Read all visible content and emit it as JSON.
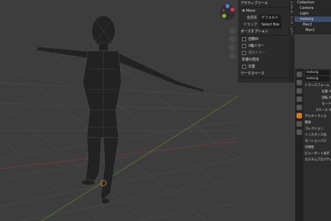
{
  "tool_panel": {
    "active_tool_header": "アクティブツール",
    "move_label": "Move",
    "orientation_label": "座標系",
    "orientation_value": "デフォルト",
    "drag_label": "ドラッグ",
    "drag_value": "Select Box",
    "pose_options_header": "ポーズオプション",
    "auto_ik": "自動IK",
    "x_mirror": "X軸ミラー",
    "relative_mirror": "相対ミラー",
    "affect_only": "影響の限定",
    "location": "位置",
    "workspace_header": "ワークスペース"
  },
  "vertical_tabs": [
    "アイテム",
    "ツール",
    "ビュー"
  ],
  "outliner": {
    "items": [
      "Collection",
      "Camera",
      "Light",
      "metarig",
      "Mac2",
      "Mac2"
    ]
  },
  "properties": {
    "object_name": "metarig",
    "data_name": "metarig",
    "transform_header": "トランスフォーム",
    "location_label": "位置 X",
    "rotation_label": "回転 X",
    "mode_label": "モード",
    "scale_label": "スケール X",
    "delta_header": "デルタトランス",
    "relations": "関係",
    "collections": "コレクション",
    "instancing": "インスタンス化",
    "motion_paths": "モーションパス",
    "visibility": "可視性",
    "viewport_display": "ビューポート表示",
    "custom_props": "カスタムプロパティ"
  },
  "colors": {
    "accent": "#3a4d6e",
    "x_axis": "#b84a4a",
    "y_axis": "#7aa02a"
  },
  "icons": [
    "move-icon",
    "zoom-icon",
    "hand-icon",
    "camera-icon",
    "grid-icon",
    "navigation-gizmo"
  ]
}
